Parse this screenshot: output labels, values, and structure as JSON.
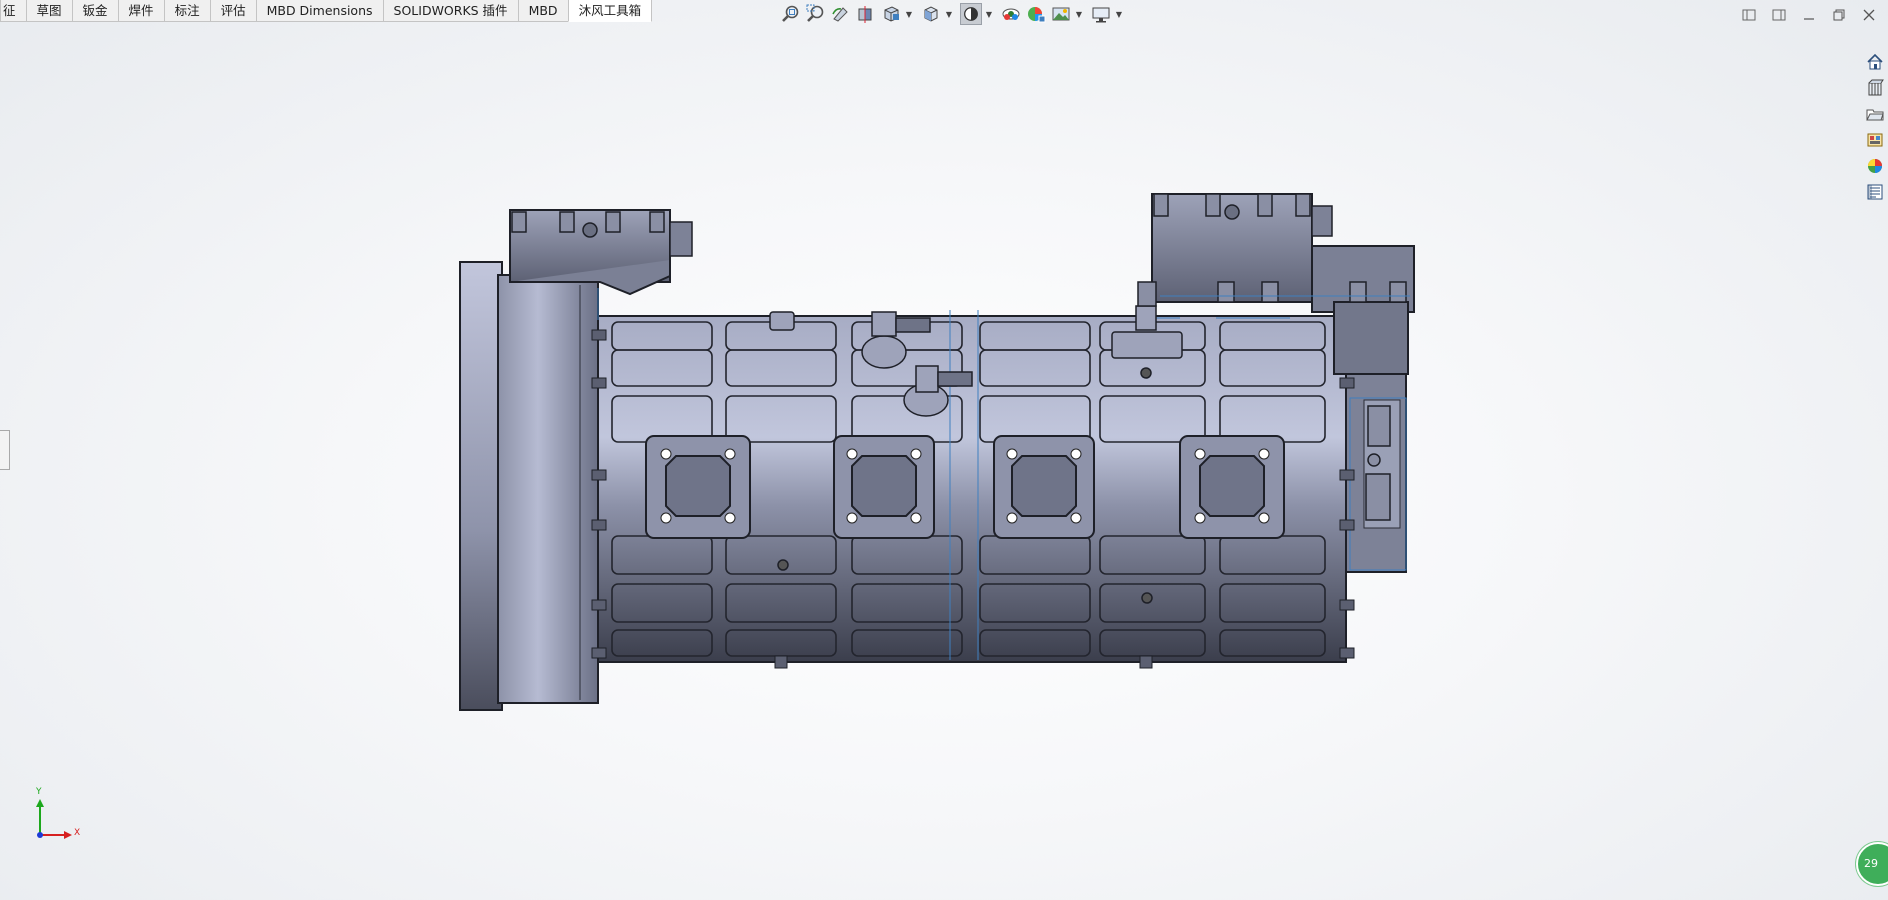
{
  "tabs": [
    {
      "label": "征",
      "active": false
    },
    {
      "label": "草图",
      "active": false
    },
    {
      "label": "钣金",
      "active": false
    },
    {
      "label": "焊件",
      "active": false
    },
    {
      "label": "标注",
      "active": false
    },
    {
      "label": "评估",
      "active": false
    },
    {
      "label": "MBD Dimensions",
      "active": false
    },
    {
      "label": "SOLIDWORKS 插件",
      "active": false
    },
    {
      "label": "MBD",
      "active": false
    },
    {
      "label": "沐风工具箱",
      "active": true
    }
  ],
  "heads_up_toolbar": [
    "zoom-to-fit-icon",
    "zoom-to-area-icon",
    "previous-view-icon",
    "section-view-icon",
    "view-orientation-icon",
    "view-selector-icon",
    "display-style-icon",
    "hide-show-items-icon",
    "edit-appearance-icon",
    "apply-scene-icon",
    "view-settings-icon"
  ],
  "window_controls": [
    "tile-left-icon",
    "tile-right-icon",
    "minimize-icon",
    "restore-icon",
    "close-icon"
  ],
  "task_pane": [
    "home-icon",
    "design-library-icon",
    "file-explorer-icon",
    "view-palette-icon",
    "appearances-icon",
    "custom-properties-icon"
  ],
  "triad": {
    "x_label": "X",
    "y_label": "Y",
    "x_color": "#d62020",
    "y_color": "#1da81d",
    "z_color": "#1c3bd6"
  },
  "notification": {
    "text": "29"
  },
  "colors": {
    "accent": "#3f7fbf",
    "model_body": "#8b90a8",
    "tab_active_bg": "#ffffff"
  }
}
